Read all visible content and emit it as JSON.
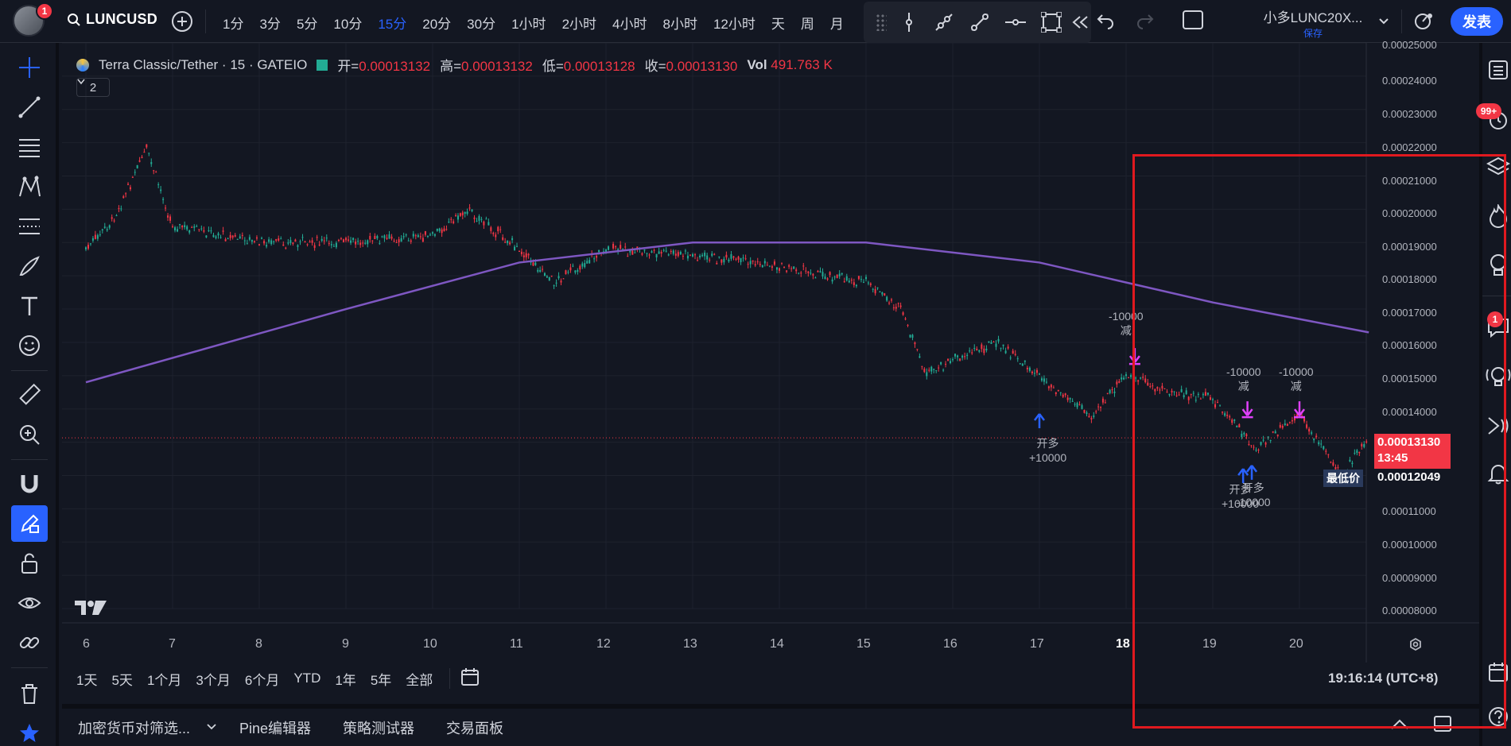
{
  "header": {
    "notification_count": "1",
    "symbol": "LUNCUSD",
    "intervals": [
      "1分",
      "3分",
      "5分",
      "10分",
      "15分",
      "20分",
      "30分",
      "1小时",
      "2小时",
      "4小时",
      "8小时",
      "12小时",
      "天",
      "周",
      "月"
    ],
    "active_interval": "15分",
    "layout_name": "小多LUNC20X...",
    "layout_status": "保存",
    "publish_label": "发表"
  },
  "legend": {
    "title": "Terra Classic/Tether · 15 · GATEIO",
    "open_label": "开=",
    "open": "0.00013132",
    "high_label": "高=",
    "high": "0.00013132",
    "low_label": "低=",
    "low": "0.00013128",
    "close_label": "收=",
    "close": "0.00013130",
    "vol_label": "Vol",
    "vol": "491.763 K",
    "indicator_count": "2"
  },
  "price_axis": {
    "labels": [
      "0.00025000",
      "0.00024000",
      "0.00023000",
      "0.00022000",
      "0.00021000",
      "0.00020000",
      "0.00019000",
      "0.00018000",
      "0.00017000",
      "0.00016000",
      "0.00015000",
      "0.00014000",
      "0.00011000",
      "0.00010000",
      "0.00009000",
      "0.00008000"
    ],
    "current_price": "0.00013130",
    "countdown": "13:45",
    "low_label": "最低价",
    "low_price": "0.00012049"
  },
  "time_axis": {
    "labels": [
      "6",
      "7",
      "8",
      "9",
      "10",
      "11",
      "12",
      "13",
      "14",
      "15",
      "16",
      "17",
      "18",
      "19",
      "20"
    ]
  },
  "annotations": [
    {
      "top": "开多",
      "bottom": "+10000"
    },
    {
      "top": "-10000",
      "bottom": "减"
    },
    {
      "top": "-10000",
      "bottom": "减"
    },
    {
      "top": "-10000",
      "bottom": "减"
    },
    {
      "top": "开多",
      "bottom": "+10000"
    },
    {
      "top": "开多",
      "bottom": "-10000"
    }
  ],
  "range_bar": {
    "ranges": [
      "1天",
      "5天",
      "1个月",
      "3个月",
      "6个月",
      "YTD",
      "1年",
      "5年",
      "全部"
    ],
    "clock": "19:16:14 (UTC+8)"
  },
  "bottom_tabs": [
    "加密货币对筛选...",
    "Pine编辑器",
    "策略测试器",
    "交易面板"
  ],
  "right_badges": {
    "alerts": "99+",
    "chat": "1"
  },
  "chart_data": {
    "type": "line",
    "series": [
      {
        "name": "LUNCUSD",
        "x": [
          "6",
          "6.3",
          "6.7",
          "7",
          "8",
          "9",
          "10",
          "10.4",
          "11",
          "11.4",
          "12",
          "13",
          "14",
          "15",
          "15.4",
          "15.7",
          "16",
          "16.5",
          "17",
          "17.6",
          "18",
          "18.5",
          "19",
          "19.5",
          "20",
          "20.5",
          "20.8"
        ],
        "values": [
          0.000188,
          0.000196,
          0.000218,
          0.000195,
          0.00019,
          0.00019,
          0.000192,
          0.0002,
          0.000188,
          0.000178,
          0.000188,
          0.000186,
          0.000183,
          0.000178,
          0.00017,
          0.00015,
          0.000155,
          0.00016,
          0.00015,
          0.000138,
          0.00015,
          0.000145,
          0.000143,
          0.000128,
          0.000138,
          0.00012,
          0.0001313
        ]
      },
      {
        "x": [
          "6",
          "9",
          "11",
          "13",
          "15",
          "17",
          "19",
          "20.8"
        ],
        "values": [
          0.000148,
          0.00017,
          0.000184,
          0.00019,
          0.00019,
          0.000184,
          0.000172,
          0.000163
        ]
      }
    ],
    "ylim": [
      8e-05,
      0.00025
    ],
    "colors": {
      "up": "#22ab94",
      "down": "#f23645",
      "ma": "#7e57c2"
    }
  }
}
